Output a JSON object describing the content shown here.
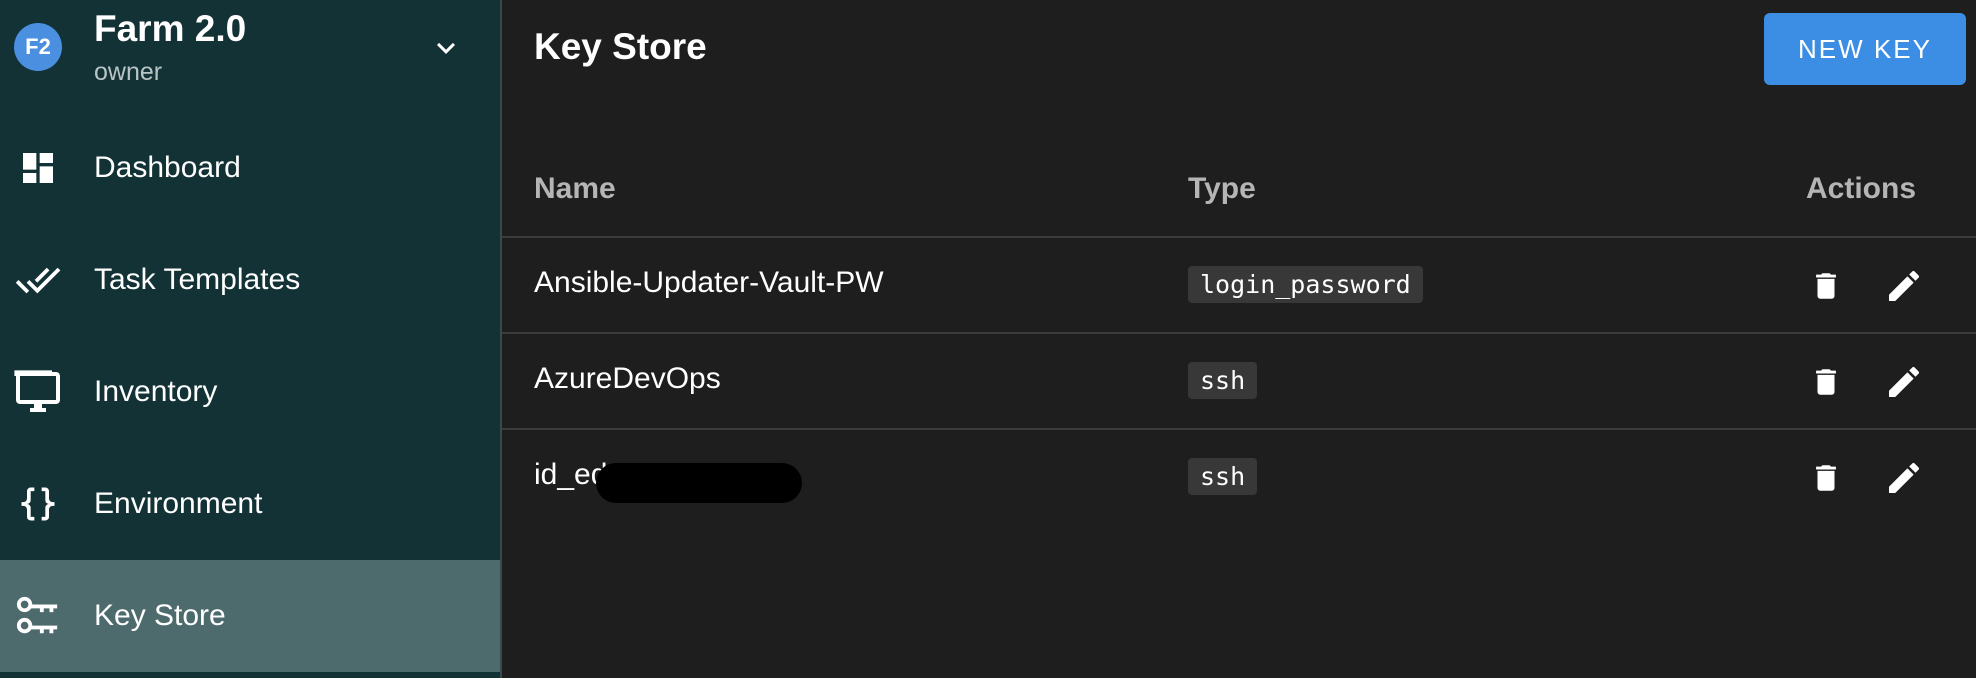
{
  "project": {
    "avatar_initials": "F2",
    "name": "Farm 2.0",
    "role": "owner"
  },
  "sidebar": {
    "items": [
      {
        "label": "Dashboard",
        "icon": "dashboard-icon"
      },
      {
        "label": "Task Templates",
        "icon": "done-all-icon"
      },
      {
        "label": "Inventory",
        "icon": "monitor-icon"
      },
      {
        "label": "Environment",
        "icon": "code-braces-icon"
      },
      {
        "label": "Key Store",
        "icon": "key-icon",
        "active": true
      }
    ]
  },
  "header": {
    "title": "Key Store",
    "new_key_label": "NEW KEY"
  },
  "table": {
    "columns": [
      "Name",
      "Type",
      "Actions"
    ],
    "rows": [
      {
        "name": "Ansible-Updater-Vault-PW",
        "type": "login_password"
      },
      {
        "name": "AzureDevOps",
        "type": "ssh"
      },
      {
        "name": "id_ed",
        "type": "ssh"
      }
    ]
  },
  "colors": {
    "sidebar_bg": "#123236",
    "sidebar_active": "#4d6b6d",
    "main_bg": "#1e1e1e",
    "accent": "#3b8ee3"
  }
}
